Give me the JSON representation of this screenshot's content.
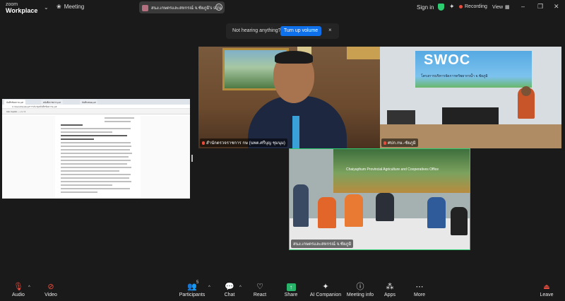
{
  "app": {
    "logo_line1": "zoom",
    "logo_line2": "Workplace",
    "meeting_label": "Meeting"
  },
  "share_pill": {
    "text": "สนง.เกษตรและสหกรณ์ จ.ชัยภูมิ's scre"
  },
  "topbar": {
    "signin": "Sign in",
    "recording": "Recording",
    "view": "View"
  },
  "notice": {
    "text": "Not hearing anything?",
    "button": "Turn up volume",
    "close": "×"
  },
  "document": {
    "tabs": [
      "บันทึกข้อความ.pdf",
      "หนังสือราชการ.pdf",
      "บันทึกเสนอ.pdf"
    ],
    "address": "C:/Users/Desktop/การประชุม/บันทึกข้อความ.pdf",
    "toolbar": "Ask Copilot   −  +   1 / 4"
  },
  "tiles": [
    {
      "name": "สำนักตรวจราชการ กษ (นพต.ศรีบุญ ชุมนุม)"
    },
    {
      "name": "ศปก.กษ.-ชัยภูมิ"
    },
    {
      "name": "สนง.เกษตรและสหกรณ์ จ.ชัยภูมิ"
    }
  ],
  "tile_text": {
    "swoc": "SWOC",
    "swoc_sub": "โครงการบริหารจัดการทรัพยากรน้ำ จ.ชัยภูมิ",
    "t3_banner": "Chaiyaphum Provincial Agriculture and Cooperatives Office"
  },
  "bottombar": {
    "audio": "Audio",
    "video": "Video",
    "participants": "Participants",
    "participants_count": "5",
    "chat": "Chat",
    "react": "React",
    "share": "Share",
    "ai": "AI Companion",
    "info": "Meeting info",
    "apps": "Apps",
    "more": "More",
    "leave": "Leave"
  },
  "colors": {
    "accent": "#0e71eb",
    "share_green": "#28b36b",
    "recording_red": "#e74c3c",
    "shield_green": "#2ecc71"
  }
}
